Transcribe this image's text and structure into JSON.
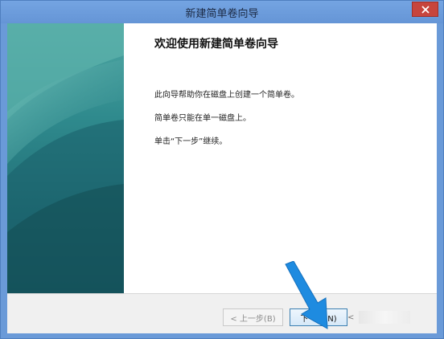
{
  "window": {
    "title": "新建简单卷向导"
  },
  "main": {
    "heading": "欢迎使用新建简单卷向导",
    "paragraphs": [
      "此向导帮助你在磁盘上创建一个简单卷。",
      "简单卷只能在单一磁盘上。",
      "单击“下一步”继续。"
    ]
  },
  "footer": {
    "back_label": "< 上一步(B)",
    "next_label": "下一步(N)",
    "more_label": "<"
  },
  "colors": {
    "titlebar": "#6a9ad8",
    "close_button": "#c7453d",
    "side_panel_dark": "#1d5f6a",
    "side_panel_light": "#3f9a9c",
    "annotation_arrow": "#1e8be0"
  },
  "icons": {
    "close": "close-icon",
    "annotation": "pointer-arrow-icon"
  }
}
